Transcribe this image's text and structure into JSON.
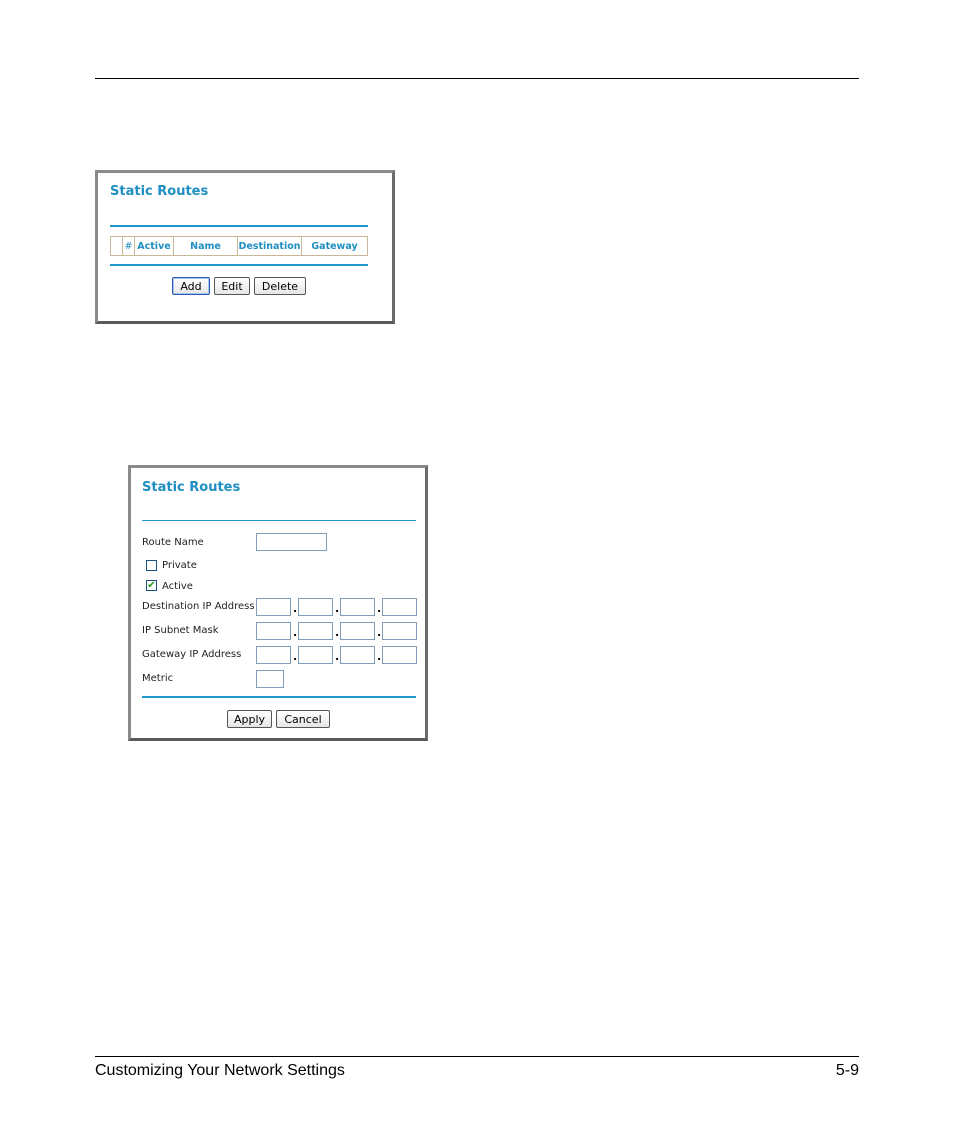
{
  "footer": {
    "section_title": "Customizing Your Network Settings",
    "page_number": "5-9"
  },
  "static_routes_table": {
    "title": "Static Routes",
    "columns": [
      "",
      "#",
      "Active",
      "Name",
      "Destination",
      "Gateway"
    ],
    "rows": [],
    "buttons": {
      "add": "Add",
      "edit": "Edit",
      "delete": "Delete"
    }
  },
  "static_route_form": {
    "title": "Static Routes",
    "route_name": {
      "label": "Route Name",
      "value": ""
    },
    "private": {
      "label": "Private",
      "checked": false
    },
    "active": {
      "label": "Active",
      "checked": true,
      "check_glyph": "✔"
    },
    "destination_ip": {
      "label": "Destination IP Address",
      "octets": [
        "",
        "",
        "",
        ""
      ]
    },
    "subnet_mask": {
      "label": "IP Subnet Mask",
      "octets": [
        "",
        "",
        "",
        ""
      ]
    },
    "gateway_ip": {
      "label": "Gateway IP Address",
      "octets": [
        "",
        "",
        "",
        ""
      ]
    },
    "metric": {
      "label": "Metric",
      "value": ""
    },
    "octet_separator": ".",
    "buttons": {
      "apply": "Apply",
      "cancel": "Cancel"
    }
  },
  "colors": {
    "accent": "#1f9acb",
    "title": "#1f8fc1"
  }
}
